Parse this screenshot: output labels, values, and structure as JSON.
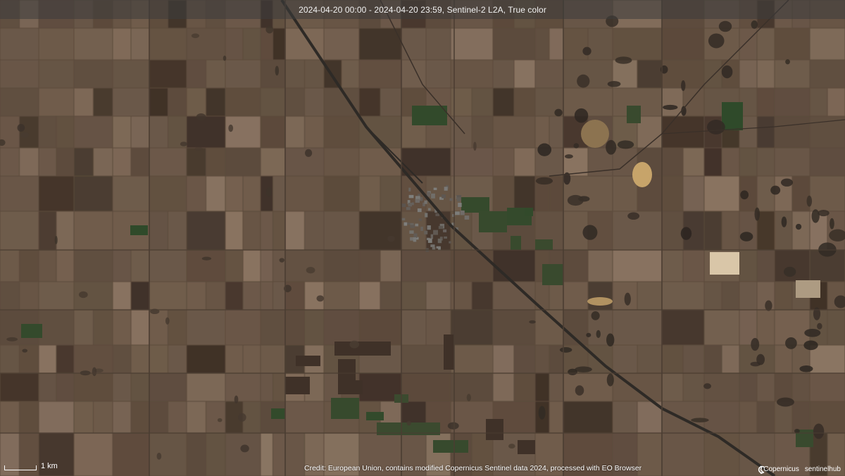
{
  "header": {
    "title": "2024-04-20 00:00 - 2024-04-20 23:59, Sentinel-2 L2A, True color"
  },
  "scale_bar": {
    "label": "1 km"
  },
  "footer": {
    "credit": "Credit: European Union, contains modified Copernicus Sentinel data 2024, processed with EO Browser",
    "logos": [
      {
        "name": "Copernicus",
        "icon": "copernicus-logo-icon"
      },
      {
        "name": "sentinelhub",
        "icon": "sentinelhub-logo-icon"
      }
    ]
  },
  "colors": {
    "land_base": "#5b4a3b",
    "field_light": "#8a7462",
    "field_dark": "#3f3128",
    "crop_green": "#2f4a2a",
    "town": "#7f7f7c",
    "road": "#2e2a26",
    "bright_patch": "#d9c6a8",
    "sand_patch": "#c7a46a"
  }
}
